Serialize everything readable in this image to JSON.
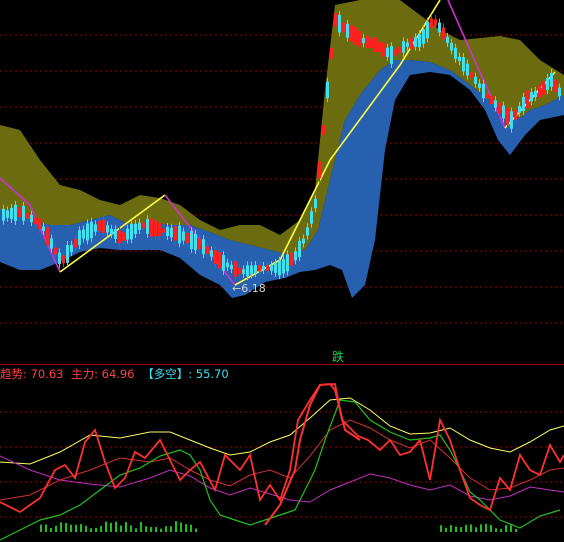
{
  "colors": {
    "background": "#000000",
    "grid": "#a00000",
    "candle_up": "#ff2020",
    "candle_down": "#40e0f0",
    "band_upper_fill": "#6b6b10",
    "band_lower_fill": "#2860b0",
    "zigzag_up": "#ffff40",
    "zigzag_down": "#d030d0",
    "trend_line": "#ff2020",
    "main_force_line": "#ff4040",
    "long_short_line": "#ffff60",
    "lower_line": "#c030c0",
    "green_series": "#20c020"
  },
  "main_chart": {
    "low_annotation": "←6.18"
  },
  "marker": {
    "label": "跌"
  },
  "indicator_header": {
    "trend_label": "趋势: 70.63",
    "main_force_label": "主力: 64.96",
    "long_short_label": "【多空】: 55.70"
  }
}
